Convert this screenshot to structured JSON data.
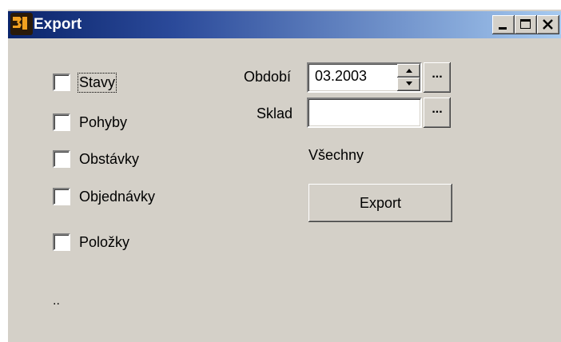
{
  "window": {
    "title": "Export",
    "title_gradient_start": "#0a246a",
    "title_gradient_end": "#a6caf0",
    "face_color": "#d4d0c8",
    "icons": {
      "app": "app-logo-icon",
      "minimize": "minimize-icon",
      "maximize": "maximize-icon",
      "close": "close-icon"
    }
  },
  "checkboxes": [
    {
      "label": "Stavy",
      "checked": false
    },
    {
      "label": "Pohyby",
      "checked": false
    },
    {
      "label": "Obstávky",
      "checked": false
    },
    {
      "label": "Objednávky",
      "checked": false
    },
    {
      "label": "Položky",
      "checked": false
    }
  ],
  "form": {
    "period_label": "Období",
    "period_value": "03.2003",
    "warehouse_label": "Sklad",
    "warehouse_value": "",
    "browse_label": "...",
    "warehouse_display": "Všechny",
    "export_button": "Export"
  },
  "status_text": ".."
}
